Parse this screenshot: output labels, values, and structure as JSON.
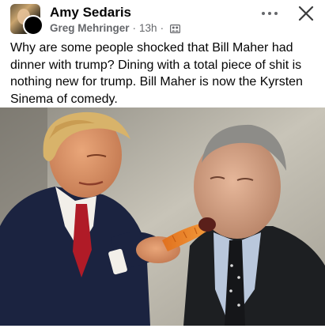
{
  "post": {
    "author_name": "Amy Sedaris",
    "shared_by": "Greg Mehringer",
    "timestamp": "13h",
    "separator": "·",
    "audience_icon": "group-icon",
    "more_icon": "more-horizontal-icon",
    "close_icon": "close-icon",
    "text": "Why are some people shocked that Bill Maher had dinner with trump? Dining with a total piece of shit is nothing new for trump. Bill Maher is now the Kyrsten Sinema of comedy.",
    "image": "Photo of two men in suits; one holds a carrot to the other's mouth"
  },
  "colors": {
    "text_primary": "#050505",
    "text_secondary": "#65676b",
    "background": "#ffffff"
  }
}
